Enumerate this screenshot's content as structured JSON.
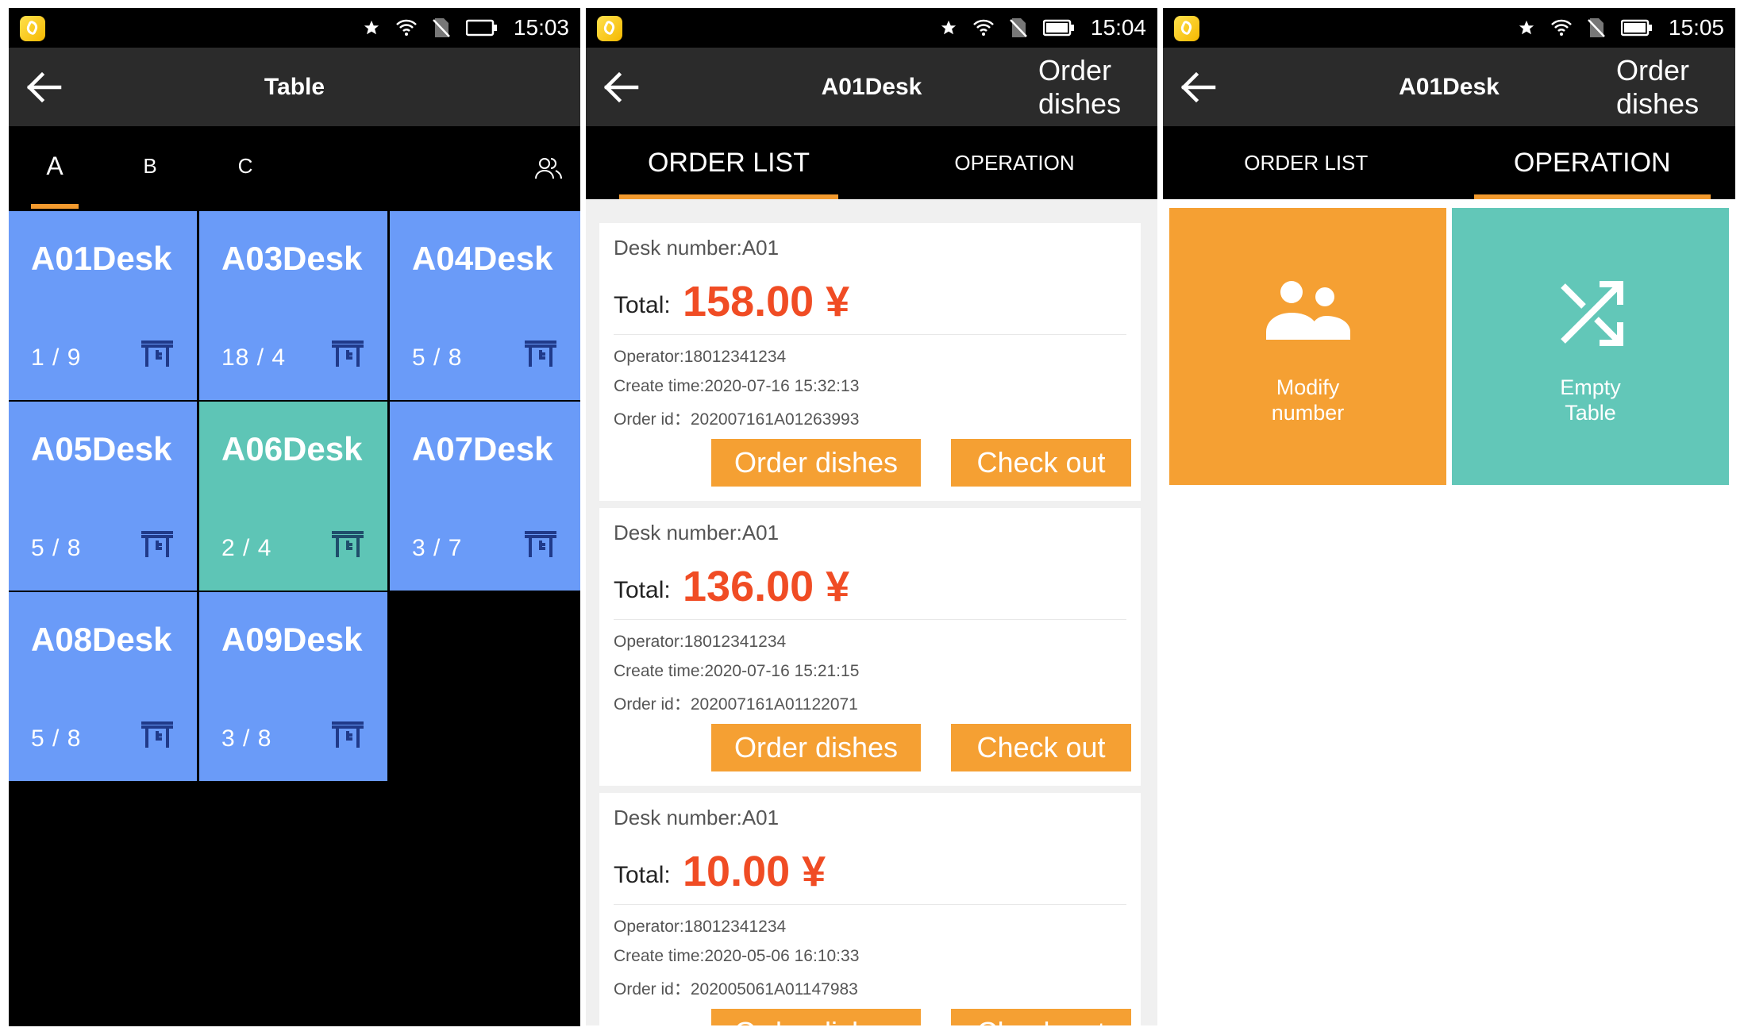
{
  "colors": {
    "orange": "#f5a033",
    "blue_desk": "#6a9bf8",
    "green_desk": "#5ec5b6",
    "teal": "#62c7b8",
    "total_red": "#f04c24"
  },
  "screens": [
    {
      "status": {
        "time": "15:03"
      },
      "appbar": {
        "title": "Table",
        "back_icon": "arrow-left-icon"
      },
      "sections": [
        "A",
        "B",
        "C"
      ],
      "active_section": "A",
      "people_icon": "people-icon",
      "desks": [
        {
          "name": "A01Desk",
          "count": "1 / 9",
          "state": "blue"
        },
        {
          "name": "A03Desk",
          "count": "18 / 4",
          "state": "blue"
        },
        {
          "name": "A04Desk",
          "count": "5 / 8",
          "state": "blue"
        },
        {
          "name": "A05Desk",
          "count": "5 / 8",
          "state": "blue"
        },
        {
          "name": "A06Desk",
          "count": "2 / 4",
          "state": "green"
        },
        {
          "name": "A07Desk",
          "count": "3 / 7",
          "state": "blue"
        },
        {
          "name": "A08Desk",
          "count": "5 / 8",
          "state": "blue"
        },
        {
          "name": "A09Desk",
          "count": "3 / 8",
          "state": "blue"
        }
      ]
    },
    {
      "status": {
        "time": "15:04"
      },
      "appbar": {
        "title": "A01Desk",
        "action_line1": "Order",
        "action_line2": "dishes"
      },
      "tabs": [
        "ORDER LIST",
        "OPERATION"
      ],
      "active_tab": "ORDER LIST",
      "orders": [
        {
          "desk": "Desk number:A01",
          "total_label": "Total:",
          "total": "158.00 ¥",
          "operator": "Operator:18012341234",
          "create_time": "Create time:2020-07-16 15:32:13",
          "order_id": "Order id：202007161A01263993",
          "order_btn": "Order dishes",
          "check_btn": "Check out"
        },
        {
          "desk": "Desk number:A01",
          "total_label": "Total:",
          "total": "136.00 ¥",
          "operator": "Operator:18012341234",
          "create_time": "Create time:2020-07-16 15:21:15",
          "order_id": "Order id：202007161A01122071",
          "order_btn": "Order dishes",
          "check_btn": "Check out"
        },
        {
          "desk": "Desk number:A01",
          "total_label": "Total:",
          "total": "10.00 ¥",
          "operator": "Operator:18012341234",
          "create_time": "Create time:2020-05-06 16:10:33",
          "order_id": "Order id：202005061A01147983",
          "order_btn": "Order dishes",
          "check_btn": "Check out"
        }
      ]
    },
    {
      "status": {
        "time": "15:05"
      },
      "appbar": {
        "title": "A01Desk",
        "action_line1": "Order",
        "action_line2": "dishes"
      },
      "tabs": [
        "ORDER LIST",
        "OPERATION"
      ],
      "active_tab": "OPERATION",
      "operations": [
        {
          "line1": "Modify",
          "line2": "number",
          "icon": "people-icon"
        },
        {
          "line1": "Empty",
          "line2": "Table",
          "icon": "shuffle-icon"
        }
      ]
    }
  ]
}
